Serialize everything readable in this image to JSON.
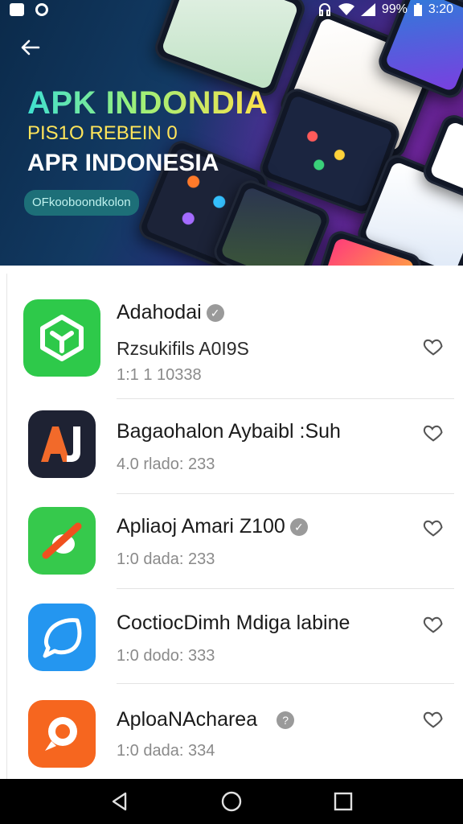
{
  "status_bar": {
    "battery": "99%",
    "time": "3:20",
    "icons": [
      "notification-icon",
      "circle-app-icon",
      "headset-icon",
      "wifi-icon",
      "signal-icon",
      "battery-icon"
    ]
  },
  "hero": {
    "back_icon": "arrow-left-icon",
    "title_line_1": "APK INDONDIA",
    "title_line_2": "PIS1O REBEIN 0",
    "title_line_3": "APR INDONESIA",
    "chip_label": "OFkooboondkolon"
  },
  "apps": [
    {
      "name": "Adahodai",
      "subtitle": "Rzsukifils A0I9S",
      "meta": "1:1 1 10338",
      "verified": true,
      "icon": "green-cube-icon",
      "icon_color": "#2ec94a"
    },
    {
      "name": "Bagaohalon Aybaibl :Suh",
      "subtitle": "",
      "meta": "4.0 rlado: 233",
      "verified": false,
      "icon": "aj-letter-icon",
      "icon_color": "#1e2233"
    },
    {
      "name": "Apliaoj Amari Z100",
      "subtitle": "",
      "meta": "1:0 dada: 233",
      "verified": true,
      "icon": "no-phone-icon",
      "icon_color": "#36c94c"
    },
    {
      "name": "CoctiocDimh Mdiga labine",
      "subtitle": "",
      "meta": "1:0 dodo: 333",
      "verified": false,
      "icon": "chat-bubble-icon",
      "icon_color": "#2496f0"
    },
    {
      "name": "AploaNAcharea",
      "subtitle": "",
      "meta": "1:0 dada: 334",
      "verified": true,
      "icon": "orange-bubble-icon",
      "icon_color": "#f6661f"
    }
  ],
  "nav": {
    "back_icon": "triangle-back-icon",
    "home_icon": "circle-home-icon",
    "recents_icon": "square-recents-icon"
  }
}
